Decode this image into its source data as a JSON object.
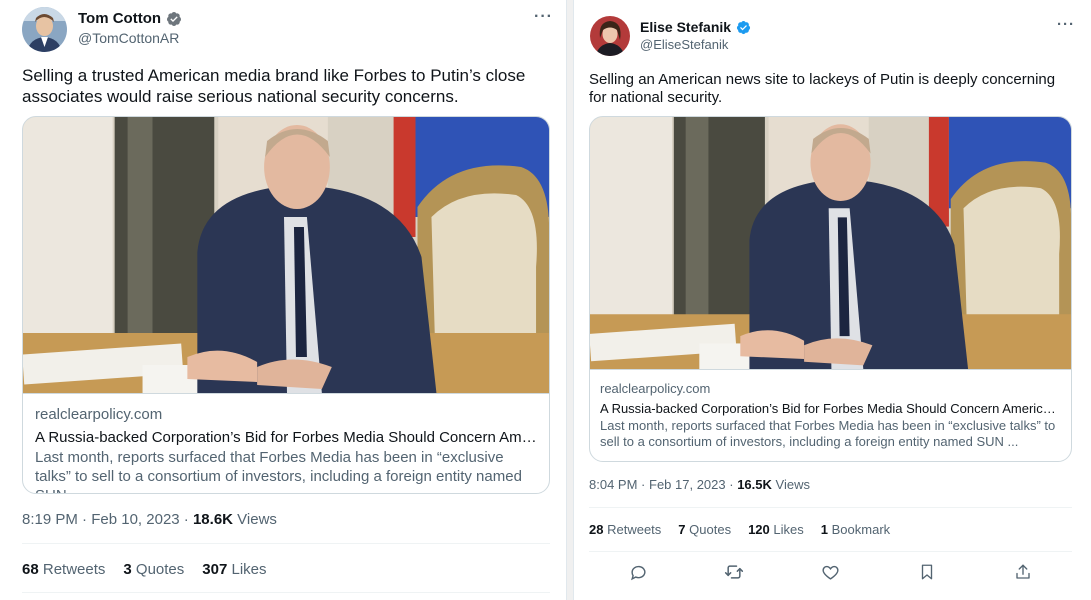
{
  "colors": {
    "text": "#0f1419",
    "secondary": "#536471",
    "border": "#cfd9de",
    "verified": "#1d9bf0",
    "divider": "#eff3f4"
  },
  "tweets": [
    {
      "author": {
        "name": "Tom Cotton",
        "handle": "@TomCottonAR"
      },
      "more_icon": "more-horizontal-icon",
      "text": "Selling a trusted American media brand like Forbes to Putin’s close associates would raise serious national security concerns.",
      "card": {
        "domain": "realclearpolicy.com",
        "title": "A Russia-backed Corporation’s Bid for Forbes Media Should Concern Americans",
        "description": "Last month, reports surfaced that Forbes Media has been in “exclusive talks” to sell to a consortium of investors, including a foreign entity named SUN ..."
      },
      "meta": {
        "time": "8:19 PM",
        "date": "Feb 10, 2023",
        "views_count": "18.6K",
        "views_label": "Views"
      },
      "stats": [
        {
          "count": "68",
          "label": "Retweets"
        },
        {
          "count": "3",
          "label": "Quotes"
        },
        {
          "count": "307",
          "label": "Likes"
        }
      ]
    },
    {
      "author": {
        "name": "Elise Stefanik",
        "handle": "@EliseStefanik"
      },
      "more_icon": "more-horizontal-icon",
      "text": "Selling an American news site to lackeys of Putin is deeply concerning for national security.",
      "card": {
        "domain": "realclearpolicy.com",
        "title": "A Russia-backed Corporation’s Bid for Forbes Media Should Concern Americans",
        "description": "Last month, reports surfaced that Forbes Media has been in “exclusive talks” to sell to a consortium of investors, including a foreign entity named SUN ..."
      },
      "meta": {
        "time": "8:04 PM",
        "date": "Feb 17, 2023",
        "views_count": "16.5K",
        "views_label": "Views"
      },
      "stats": [
        {
          "count": "28",
          "label": "Retweets"
        },
        {
          "count": "7",
          "label": "Quotes"
        },
        {
          "count": "120",
          "label": "Likes"
        },
        {
          "count": "1",
          "label": "Bookmark"
        }
      ],
      "actions": [
        "reply-icon",
        "retweet-icon",
        "like-icon",
        "bookmark-icon",
        "share-icon"
      ]
    }
  ]
}
